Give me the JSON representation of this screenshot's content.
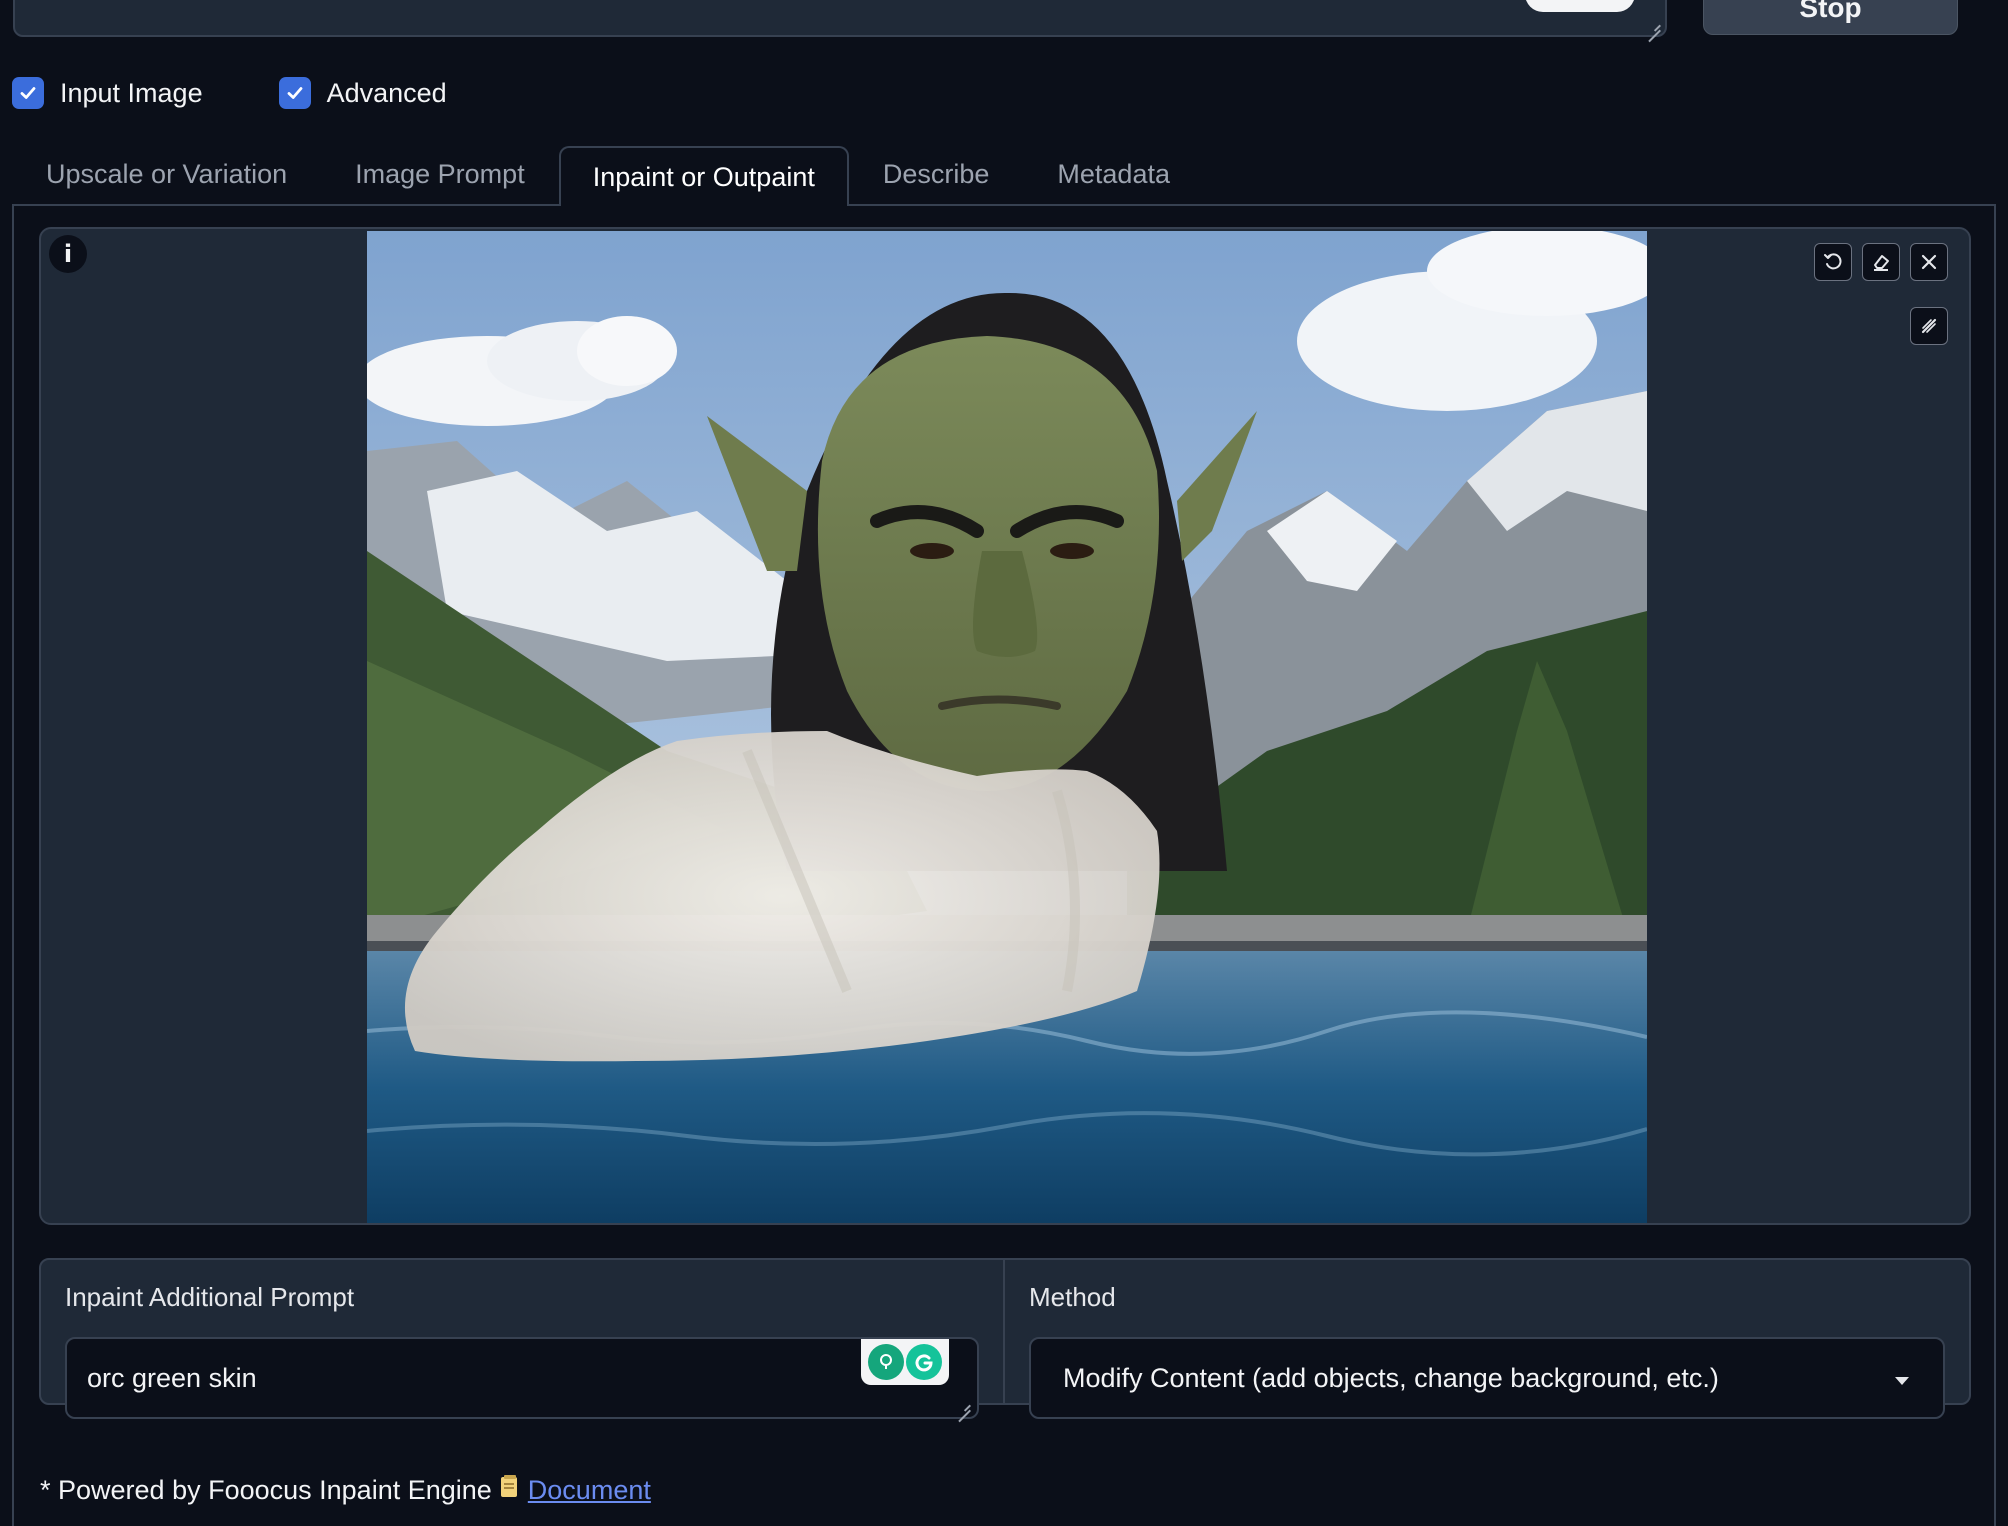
{
  "header": {
    "stop_label": "Stop"
  },
  "checkboxes": [
    {
      "label": "Input Image",
      "checked": true
    },
    {
      "label": "Advanced",
      "checked": true
    }
  ],
  "tabs": [
    {
      "label": "Upscale or Variation",
      "active": false
    },
    {
      "label": "Image Prompt",
      "active": false
    },
    {
      "label": "Inpaint or Outpaint",
      "active": true
    },
    {
      "label": "Describe",
      "active": false
    },
    {
      "label": "Metadata",
      "active": false
    }
  ],
  "editor": {
    "info_label": "i",
    "image_description_icon": "inpaint-canvas-image",
    "tools": [
      "undo-icon",
      "eraser-icon",
      "close-icon",
      "brush-icon"
    ]
  },
  "inpaint_prompt": {
    "label": "Inpaint Additional Prompt",
    "value": "orc green skin"
  },
  "method": {
    "label": "Method",
    "selected": "Modify Content (add objects, change background, etc.)"
  },
  "footer": {
    "prefix": "* Powered by Fooocus Inpaint Engine",
    "link_label": "Document"
  },
  "colors": {
    "background": "#0b0f19",
    "panel": "#1f2937",
    "border": "#374151",
    "accent": "#3b6ddc",
    "link": "#6b8cf0"
  }
}
